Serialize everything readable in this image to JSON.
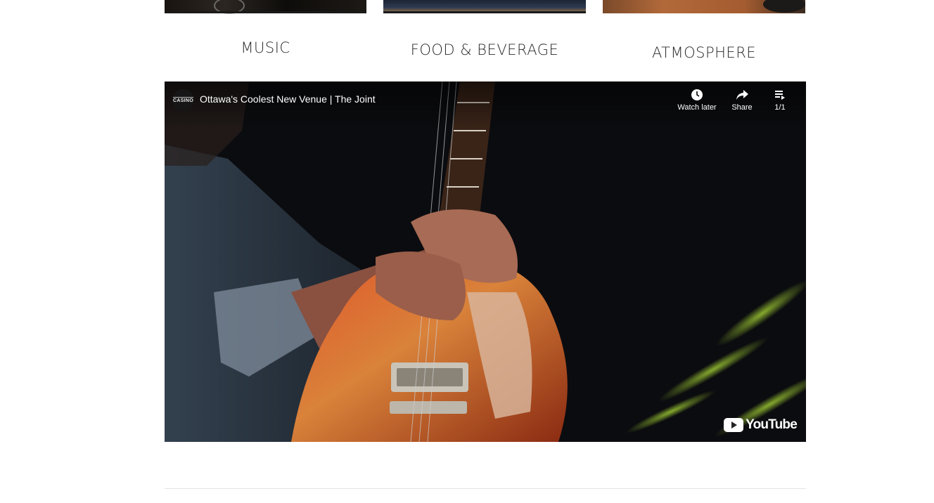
{
  "categories": [
    {
      "label": "MUSIC"
    },
    {
      "label": "FOOD & BEVERAGE"
    },
    {
      "label": "ATMOSPHERE"
    }
  ],
  "video": {
    "channel_logo_text": "CASINO",
    "title": "Ottawa's Coolest New Venue | The Joint",
    "watch_later_label": "Watch later",
    "share_label": "Share",
    "playlist_label": "1/1",
    "brand_label": "YouTube"
  }
}
